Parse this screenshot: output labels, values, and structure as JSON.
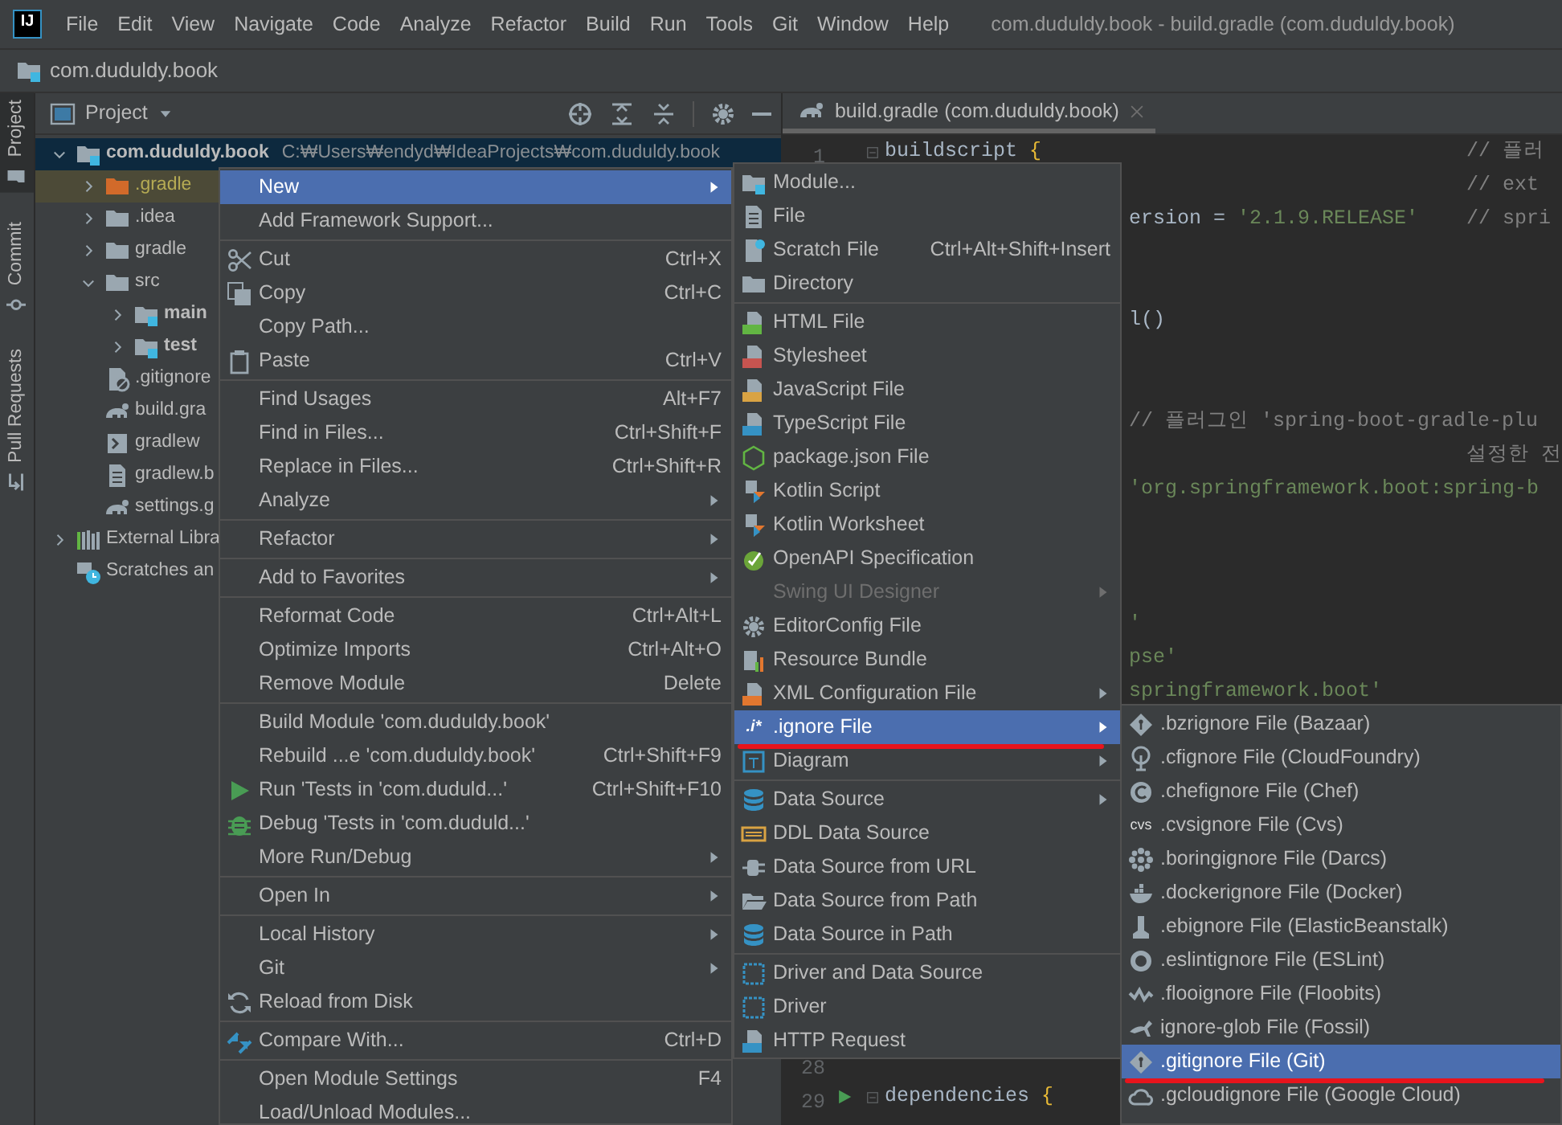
{
  "window": {
    "logo": "IJ",
    "title": "com.duduldy.book - build.gradle (com.duduldy.book)"
  },
  "menu_bar": [
    "File",
    "Edit",
    "View",
    "Navigate",
    "Code",
    "Analyze",
    "Refactor",
    "Build",
    "Run",
    "Tools",
    "Git",
    "Window",
    "Help"
  ],
  "breadcrumb": "com.duduldy.book",
  "tool_strip": [
    {
      "label": "Project",
      "selected": true
    },
    {
      "label": "Commit",
      "selected": false
    },
    {
      "label": "Pull Requests",
      "selected": false
    }
  ],
  "project_panel": {
    "title": "Project",
    "tree": [
      {
        "label": "com.duduldy.book",
        "detail": "C:₩Users₩endyd₩IdeaProjects₩com.duduldy.book",
        "kind": "module",
        "expanded": true,
        "selected": true,
        "children": [
          {
            "label": ".gradle",
            "kind": "excluded_folder",
            "expanded": false,
            "selected": false
          },
          {
            "label": ".idea",
            "kind": "folder",
            "expanded": false,
            "selected": false
          },
          {
            "label": "gradle",
            "kind": "folder",
            "expanded": false,
            "selected": false
          },
          {
            "label": "src",
            "kind": "folder",
            "expanded": true,
            "selected": false,
            "children": [
              {
                "label": "main",
                "kind": "module_folder",
                "expanded": false,
                "selected": false
              },
              {
                "label": "test",
                "kind": "module_folder",
                "expanded": false,
                "selected": false
              }
            ]
          },
          {
            "label": ".gitignore",
            "kind": "ignore_file",
            "selected": false
          },
          {
            "label": "build.gra",
            "kind": "gradle_file",
            "selected": false
          },
          {
            "label": "gradlew",
            "kind": "script_file",
            "selected": false
          },
          {
            "label": "gradlew.b",
            "kind": "text_file",
            "selected": false
          },
          {
            "label": "settings.g",
            "kind": "gradle_file",
            "selected": false
          }
        ]
      },
      {
        "label": "External Libra",
        "kind": "libraries",
        "expanded": false,
        "selected": false
      },
      {
        "label": "Scratches an",
        "kind": "scratches",
        "selected": false
      }
    ]
  },
  "editor": {
    "tab": "build.gradle (com.duduldy.book)",
    "lines": [
      {
        "kind": "code",
        "number": "1",
        "fold": true,
        "left": [
          {
            "text": "buildscript",
            "kind": "code"
          },
          {
            "text": "{",
            "kind": "brace"
          }
        ],
        "right": [
          {
            "text": "// 플러",
            "kind": "comment"
          }
        ]
      },
      {
        "kind": "code",
        "right": [
          {
            "text": "// ext",
            "kind": "comment"
          }
        ]
      },
      {
        "kind": "code",
        "middle": [
          {
            "text": "ersion =",
            "kind": "code"
          },
          {
            "text": "'2.1.9.RELEASE'",
            "kind": "string"
          }
        ],
        "right": [
          {
            "text": "// spri",
            "kind": "comment"
          }
        ]
      },
      {
        "kind": "blank"
      },
      {
        "kind": "blank"
      },
      {
        "kind": "code",
        "middle": [
          {
            "text": "l()",
            "kind": "code"
          }
        ]
      },
      {
        "kind": "blank"
      },
      {
        "kind": "blank"
      },
      {
        "kind": "code",
        "middle": [
          {
            "text": "// 플러그인 'spring-boot-gradle-plu",
            "kind": "comment"
          }
        ]
      },
      {
        "kind": "code",
        "right": [
          {
            "text": "설정한 전",
            "kind": "comment"
          }
        ]
      },
      {
        "kind": "code",
        "middle": [
          {
            "text": "'org.springframework.boot:spring-b",
            "kind": "string"
          }
        ]
      },
      {
        "kind": "blank"
      },
      {
        "kind": "blank"
      },
      {
        "kind": "blank"
      },
      {
        "kind": "code",
        "middle": [
          {
            "text": "'",
            "kind": "string"
          }
        ]
      },
      {
        "kind": "code",
        "middle": [
          {
            "text": "pse'",
            "kind": "string"
          }
        ]
      },
      {
        "kind": "code",
        "middle": [
          {
            "text": "springframework.boot'",
            "kind": "string"
          }
        ]
      },
      {
        "kind": "blank"
      },
      {
        "kind": "blank"
      },
      {
        "kind": "blank"
      },
      {
        "kind": "blank"
      },
      {
        "kind": "blank"
      },
      {
        "kind": "blank"
      },
      {
        "kind": "blank"
      },
      {
        "kind": "blank"
      },
      {
        "kind": "blank"
      },
      {
        "kind": "blank"
      },
      {
        "kind": "code",
        "number": "28"
      },
      {
        "kind": "code",
        "number": "29",
        "run": true,
        "fold": true,
        "left": [
          {
            "text": "dependencies",
            "kind": "code"
          },
          {
            "text": "{",
            "kind": "brace"
          }
        ]
      }
    ]
  },
  "context_menu": {
    "items": [
      {
        "kind": "item",
        "label": "New",
        "submenu": true,
        "selected": true
      },
      {
        "kind": "item",
        "label": "Add Framework Support...",
        "submenu": false,
        "selected": false
      },
      {
        "kind": "separator"
      },
      {
        "kind": "item",
        "label": "Cut",
        "shortcut": "Ctrl+X",
        "submenu": false,
        "selected": false
      },
      {
        "kind": "item",
        "label": "Copy",
        "shortcut": "Ctrl+C",
        "submenu": false,
        "selected": false
      },
      {
        "kind": "item",
        "label": "Copy Path...",
        "submenu": false,
        "selected": false
      },
      {
        "kind": "item",
        "label": "Paste",
        "shortcut": "Ctrl+V",
        "submenu": false,
        "selected": false
      },
      {
        "kind": "separator"
      },
      {
        "kind": "item",
        "label": "Find Usages",
        "shortcut": "Alt+F7",
        "submenu": false,
        "selected": false
      },
      {
        "kind": "item",
        "label": "Find in Files...",
        "shortcut": "Ctrl+Shift+F",
        "submenu": false,
        "selected": false
      },
      {
        "kind": "item",
        "label": "Replace in Files...",
        "shortcut": "Ctrl+Shift+R",
        "submenu": false,
        "selected": false
      },
      {
        "kind": "item",
        "label": "Analyze",
        "submenu": true,
        "selected": false
      },
      {
        "kind": "separator"
      },
      {
        "kind": "item",
        "label": "Refactor",
        "submenu": true,
        "selected": false
      },
      {
        "kind": "separator"
      },
      {
        "kind": "item",
        "label": "Add to Favorites",
        "submenu": true,
        "selected": false
      },
      {
        "kind": "separator"
      },
      {
        "kind": "item",
        "label": "Reformat Code",
        "shortcut": "Ctrl+Alt+L",
        "submenu": false,
        "selected": false
      },
      {
        "kind": "item",
        "label": "Optimize Imports",
        "shortcut": "Ctrl+Alt+O",
        "submenu": false,
        "selected": false
      },
      {
        "kind": "item",
        "label": "Remove Module",
        "shortcut": "Delete",
        "submenu": false,
        "selected": false
      },
      {
        "kind": "separator"
      },
      {
        "kind": "item",
        "label": "Build Module 'com.duduldy.book'",
        "submenu": false,
        "selected": false
      },
      {
        "kind": "item",
        "label": "Rebuild ...e 'com.duduldy.book'",
        "shortcut": "Ctrl+Shift+F9",
        "submenu": false,
        "selected": false
      },
      {
        "kind": "item",
        "label": "Run 'Tests in 'com.duduld...'",
        "shortcut": "Ctrl+Shift+F10",
        "submenu": false,
        "selected": false
      },
      {
        "kind": "item",
        "label": "Debug 'Tests in 'com.duduld...'",
        "submenu": false,
        "selected": false
      },
      {
        "kind": "item",
        "label": "More Run/Debug",
        "submenu": true,
        "selected": false
      },
      {
        "kind": "separator"
      },
      {
        "kind": "item",
        "label": "Open In",
        "submenu": true,
        "selected": false
      },
      {
        "kind": "separator"
      },
      {
        "kind": "item",
        "label": "Local History",
        "submenu": true,
        "selected": false
      },
      {
        "kind": "item",
        "label": "Git",
        "submenu": true,
        "selected": false
      },
      {
        "kind": "item",
        "label": "Reload from Disk",
        "submenu": false,
        "selected": false
      },
      {
        "kind": "separator"
      },
      {
        "kind": "item",
        "label": "Compare With...",
        "shortcut": "Ctrl+D",
        "submenu": false,
        "selected": false
      },
      {
        "kind": "separator"
      },
      {
        "kind": "item",
        "label": "Open Module Settings",
        "shortcut": "F4",
        "submenu": false,
        "selected": false
      },
      {
        "kind": "item",
        "label": "Load/Unload Modules...",
        "submenu": false,
        "selected": false
      }
    ]
  },
  "new_submenu": {
    "items": [
      {
        "kind": "item",
        "label": "Module...",
        "submenu": false,
        "selected": false,
        "disabled": false,
        "underlined": false
      },
      {
        "kind": "item",
        "label": "File",
        "submenu": false,
        "selected": false,
        "disabled": false,
        "underlined": false
      },
      {
        "kind": "item",
        "label": "Scratch File",
        "shortcut": "Ctrl+Alt+Shift+Insert",
        "submenu": false,
        "selected": false,
        "disabled": false,
        "underlined": false
      },
      {
        "kind": "item",
        "label": "Directory",
        "submenu": false,
        "selected": false,
        "disabled": false,
        "underlined": false
      },
      {
        "kind": "separator"
      },
      {
        "kind": "item",
        "label": "HTML File",
        "submenu": false,
        "selected": false,
        "disabled": false,
        "underlined": false
      },
      {
        "kind": "item",
        "label": "Stylesheet",
        "submenu": false,
        "selected": false,
        "disabled": false,
        "underlined": false
      },
      {
        "kind": "item",
        "label": "JavaScript File",
        "submenu": false,
        "selected": false,
        "disabled": false,
        "underlined": false
      },
      {
        "kind": "item",
        "label": "TypeScript File",
        "submenu": false,
        "selected": false,
        "disabled": false,
        "underlined": false
      },
      {
        "kind": "item",
        "label": "package.json File",
        "submenu": false,
        "selected": false,
        "disabled": false,
        "underlined": false
      },
      {
        "kind": "item",
        "label": "Kotlin Script",
        "submenu": false,
        "selected": false,
        "disabled": false,
        "underlined": false
      },
      {
        "kind": "item",
        "label": "Kotlin Worksheet",
        "submenu": false,
        "selected": false,
        "disabled": false,
        "underlined": false
      },
      {
        "kind": "item",
        "label": "OpenAPI Specification",
        "submenu": false,
        "selected": false,
        "disabled": false,
        "underlined": false
      },
      {
        "kind": "item",
        "label": "Swing UI Designer",
        "submenu": true,
        "selected": false,
        "disabled": true,
        "underlined": false
      },
      {
        "kind": "item",
        "label": "EditorConfig File",
        "submenu": false,
        "selected": false,
        "disabled": false,
        "underlined": false
      },
      {
        "kind": "item",
        "label": "Resource Bundle",
        "submenu": false,
        "selected": false,
        "disabled": false,
        "underlined": false
      },
      {
        "kind": "item",
        "label": "XML Configuration File",
        "submenu": true,
        "selected": false,
        "disabled": false,
        "underlined": false
      },
      {
        "kind": "item",
        "label": ".ignore File",
        "icon_text": ".i*",
        "submenu": true,
        "selected": true,
        "disabled": false,
        "underlined": true
      },
      {
        "kind": "item",
        "label": "Diagram",
        "submenu": true,
        "selected": false,
        "disabled": false,
        "underlined": false
      },
      {
        "kind": "separator"
      },
      {
        "kind": "item",
        "label": "Data Source",
        "submenu": true,
        "selected": false,
        "disabled": false,
        "underlined": false
      },
      {
        "kind": "item",
        "label": "DDL Data Source",
        "submenu": false,
        "selected": false,
        "disabled": false,
        "underlined": false
      },
      {
        "kind": "item",
        "label": "Data Source from URL",
        "submenu": false,
        "selected": false,
        "disabled": false,
        "underlined": false
      },
      {
        "kind": "item",
        "label": "Data Source from Path",
        "submenu": false,
        "selected": false,
        "disabled": false,
        "underlined": false
      },
      {
        "kind": "item",
        "label": "Data Source in Path",
        "submenu": false,
        "selected": false,
        "disabled": false,
        "underlined": false
      },
      {
        "kind": "separator"
      },
      {
        "kind": "item",
        "label": "Driver and Data Source",
        "submenu": false,
        "selected": false,
        "disabled": false,
        "underlined": false
      },
      {
        "kind": "item",
        "label": "Driver",
        "submenu": false,
        "selected": false,
        "disabled": false,
        "underlined": false
      },
      {
        "kind": "item",
        "label": "HTTP Request",
        "submenu": false,
        "selected": false,
        "disabled": false,
        "underlined": false
      }
    ]
  },
  "ignore_submenu": {
    "items": [
      {
        "kind": "item",
        "label": ".bzrignore File (Bazaar)",
        "selected": false,
        "underlined": false
      },
      {
        "kind": "item",
        "label": ".cfignore File (CloudFoundry)",
        "selected": false,
        "underlined": false
      },
      {
        "kind": "item",
        "label": ".chefignore File (Chef)",
        "selected": false,
        "underlined": false
      },
      {
        "kind": "item",
        "label": ".cvsignore File (Cvs)",
        "icon_text": "cvs",
        "selected": false,
        "underlined": false
      },
      {
        "kind": "item",
        "label": ".boringignore File (Darcs)",
        "selected": false,
        "underlined": false
      },
      {
        "kind": "item",
        "label": ".dockerignore File (Docker)",
        "selected": false,
        "underlined": false
      },
      {
        "kind": "item",
        "label": ".ebignore File (ElasticBeanstalk)",
        "selected": false,
        "underlined": false
      },
      {
        "kind": "item",
        "label": ".eslintignore File (ESLint)",
        "selected": false,
        "underlined": false
      },
      {
        "kind": "item",
        "label": ".flooignore File (Floobits)",
        "selected": false,
        "underlined": false
      },
      {
        "kind": "item",
        "label": "ignore-glob File (Fossil)",
        "selected": false,
        "underlined": false
      },
      {
        "kind": "item",
        "label": ".gitignore File (Git)",
        "selected": true,
        "underlined": true
      },
      {
        "kind": "item",
        "label": ".gcloudignore File (Google Cloud)",
        "selected": false,
        "underlined": false
      }
    ]
  }
}
